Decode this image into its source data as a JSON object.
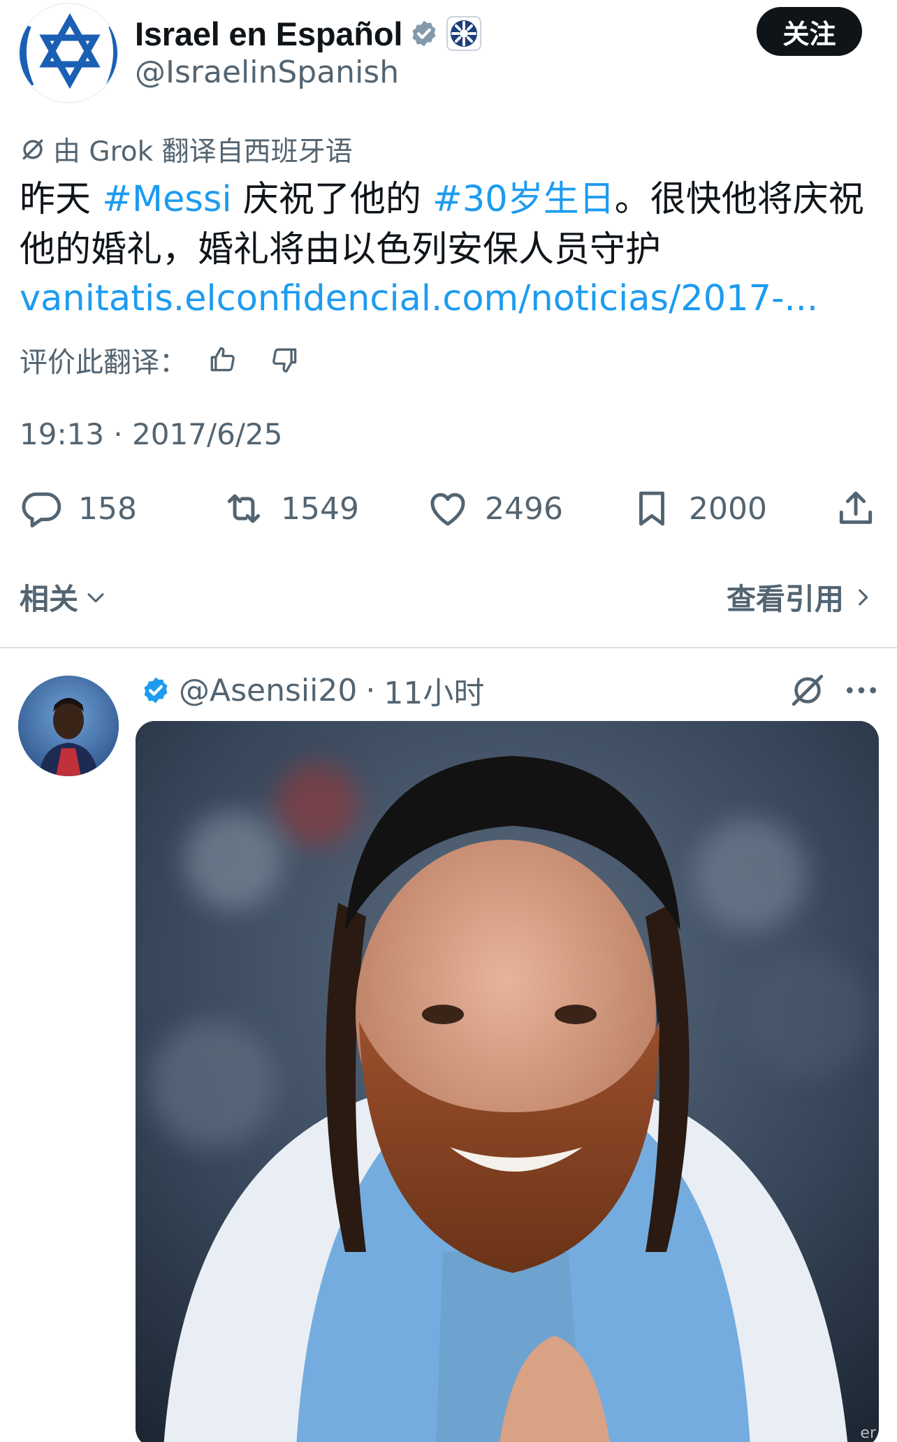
{
  "header": {
    "display_name": "Israel en Español",
    "handle": "@IsraelinSpanish",
    "follow_label": "关注"
  },
  "translation": {
    "note": "由 Grok 翻译自西班牙语",
    "rate_label": "评价此翻译："
  },
  "tweet": {
    "text_before_1": "昨天 ",
    "hashtag_1": "#Messi",
    "text_between": " 庆祝了他的 ",
    "hashtag_2": "#30岁生日",
    "text_after": "。很快他将庆祝他的婚礼，婚礼将由以色列安保人员守护",
    "link": "vanitatis.elconfidencial.com/noticias/2017-...",
    "timestamp": "19:13 · 2017/6/25"
  },
  "actions": {
    "replies": "158",
    "reposts": "1549",
    "likes": "2496",
    "bookmarks": "2000"
  },
  "related": {
    "related_label": "相关",
    "view_quotes_label": "查看引用"
  },
  "quoted_post": {
    "handle": "@Asensii20",
    "time": "11小时"
  },
  "colors": {
    "link_blue": "#1d9bf0",
    "secondary_text": "#536471",
    "primary_text": "#0f1419",
    "follow_button_bg": "#0f1419"
  }
}
